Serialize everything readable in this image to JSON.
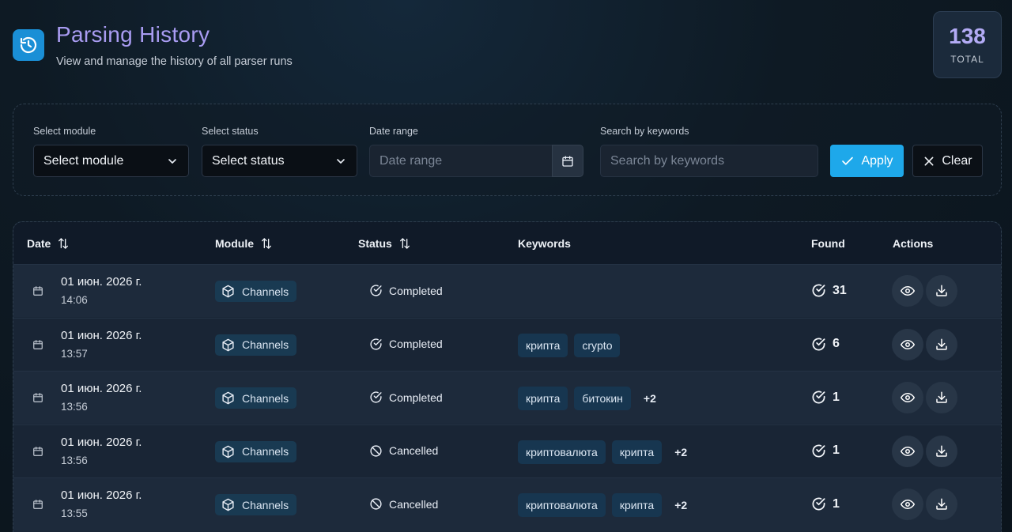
{
  "header": {
    "title": "Parsing History",
    "subtitle": "View and manage the history of all parser runs",
    "total_count": "138",
    "total_label": "TOTAL"
  },
  "filters": {
    "module_label": "Select module",
    "module_value": "Select module",
    "status_label": "Select status",
    "status_value": "Select status",
    "date_label": "Date range",
    "date_placeholder": "Date range",
    "search_label": "Search by keywords",
    "search_placeholder": "Search by keywords",
    "apply_label": "Apply",
    "clear_label": "Clear"
  },
  "table": {
    "columns": {
      "date": "Date",
      "module": "Module",
      "status": "Status",
      "keywords": "Keywords",
      "found": "Found",
      "actions": "Actions"
    },
    "rows": [
      {
        "date": "01 июн. 2026 г.",
        "time": "14:06",
        "module": "Channels",
        "status": "Completed",
        "keywords": [],
        "more": "",
        "found": "31"
      },
      {
        "date": "01 июн. 2026 г.",
        "time": "13:57",
        "module": "Channels",
        "status": "Completed",
        "keywords": [
          "крипта",
          "crypto"
        ],
        "more": "",
        "found": "6"
      },
      {
        "date": "01 июн. 2026 г.",
        "time": "13:56",
        "module": "Channels",
        "status": "Completed",
        "keywords": [
          "крипта",
          "битокин"
        ],
        "more": "+2",
        "found": "1"
      },
      {
        "date": "01 июн. 2026 г.",
        "time": "13:56",
        "module": "Channels",
        "status": "Cancelled",
        "keywords": [
          "криптовалюта",
          "крипта"
        ],
        "more": "+2",
        "found": "1"
      },
      {
        "date": "01 июн. 2026 г.",
        "time": "13:55",
        "module": "Channels",
        "status": "Cancelled",
        "keywords": [
          "криптовалюта",
          "крипта"
        ],
        "more": "+2",
        "found": "1"
      }
    ]
  },
  "colors": {
    "accent": "#1ea8ea",
    "title": "#a99cf2",
    "chip_bg": "#173650"
  }
}
